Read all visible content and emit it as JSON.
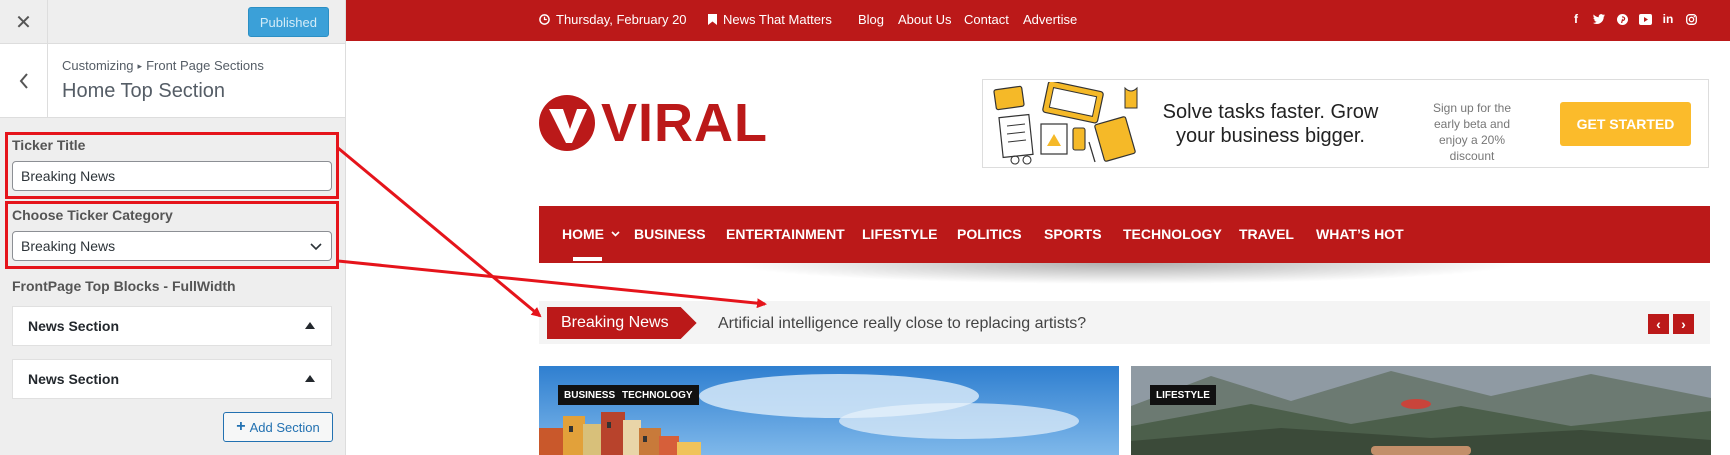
{
  "customizer": {
    "close_icon": "close-icon",
    "publish_label": "Published",
    "breadcrumb": [
      "Customizing",
      "Front Page Sections"
    ],
    "section_title": "Home Top Section",
    "ticker_title_label": "Ticker Title",
    "ticker_title_value": "Breaking News",
    "ticker_category_label": "Choose Ticker Category",
    "ticker_category_value": "Breaking News",
    "blocks_label": "FrontPage Top Blocks - FullWidth",
    "accordions": [
      "News Section",
      "News Section"
    ],
    "add_section_label": "Add Section"
  },
  "site": {
    "topbar": {
      "date": "Thursday, February 20",
      "tagline": "News That Matters",
      "links": [
        "Blog",
        "About Us",
        "Contact",
        "Advertise"
      ],
      "social_icons": [
        "facebook-icon",
        "twitter-icon",
        "pinterest-icon",
        "youtube-icon",
        "linkedin-icon",
        "instagram-icon"
      ]
    },
    "logo_text": "VIRAL",
    "ad": {
      "headline": "Solve tasks faster. Grow your business bigger.",
      "subtext": "Sign up for the early beta and enjoy a 20% discount",
      "cta": "GET STARTED"
    },
    "nav": [
      "HOME",
      "BUSINESS",
      "ENTERTAINMENT",
      "LIFESTYLE",
      "POLITICS",
      "SPORTS",
      "TECHNOLOGY",
      "TRAVEL",
      "WHAT’S HOT"
    ],
    "ticker": {
      "label": "Breaking News",
      "headline": "Artificial intelligence really close to replacing artists?"
    },
    "cards": [
      {
        "tags": [
          "BUSINESS",
          "TECHNOLOGY"
        ]
      },
      {
        "tags": [
          "LIFESTYLE"
        ]
      }
    ]
  },
  "colors": {
    "brand_red": "#bb1919",
    "annotation_red": "#e5141b",
    "publish_blue": "#3ba0d8",
    "cta_yellow": "#fbbb2b"
  }
}
